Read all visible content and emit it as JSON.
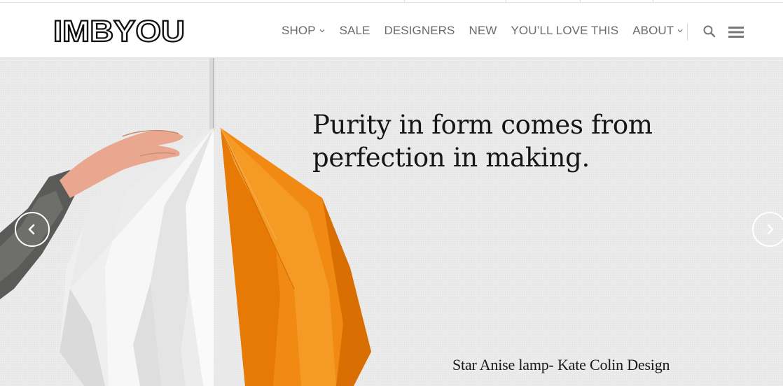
{
  "brand": {
    "logo_text": "IMBYOU"
  },
  "nav": {
    "items": [
      {
        "label": "SHOP",
        "dropdown": true
      },
      {
        "label": "SALE",
        "dropdown": false
      },
      {
        "label": "DESIGNERS",
        "dropdown": false
      },
      {
        "label": "NEW",
        "dropdown": false
      },
      {
        "label": "YOU’LL LOVE THIS",
        "dropdown": false
      },
      {
        "label": "ABOUT",
        "dropdown": true
      }
    ],
    "icons": {
      "search": "search-icon",
      "menu": "hamburger-menu-icon"
    }
  },
  "hero": {
    "headline_line1": "Purity in form comes from",
    "headline_line2": "perfection in making.",
    "caption": "Star Anise lamp- Kate Colin Design",
    "controls": {
      "prev": "chevron-left-icon",
      "next": "chevron-right-icon"
    }
  },
  "colors": {
    "nav_text": "#6b6b6b",
    "headline": "#161616",
    "hero_bg": "#ebebeb",
    "lamp_orange": "#f08a12",
    "lamp_white": "#f2f2f2"
  }
}
